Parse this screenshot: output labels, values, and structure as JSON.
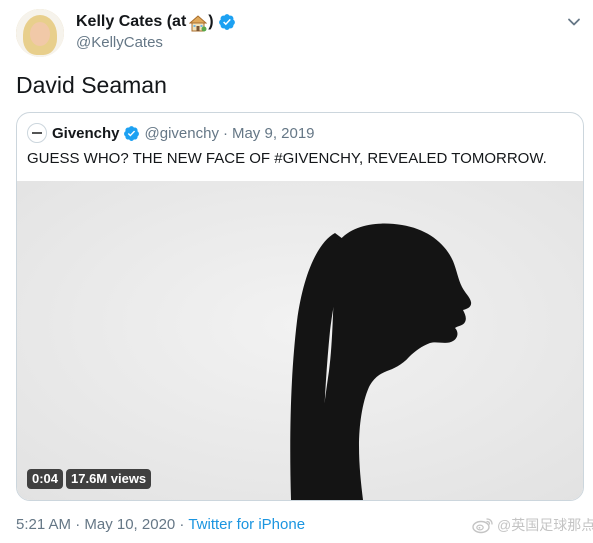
{
  "author": {
    "display_name_prefix": "Kelly Cates (at",
    "display_name_suffix": ")",
    "handle": "@KellyCates",
    "avatar_icon": "profile-photo",
    "verified_icon": "verified-badge-icon"
  },
  "tweet": {
    "text": "David Seaman",
    "timestamp": "5:21 AM · May 10, 2020",
    "separator": " · ",
    "source": "Twitter for iPhone"
  },
  "quoted_tweet": {
    "name": "Givenchy",
    "handle": "@givenchy",
    "dot": "·",
    "date": "May 9, 2019",
    "text": "GUESS WHO? THE NEW FACE OF #GIVENCHY, REVEALED TOMORROW.",
    "video": {
      "duration": "0:04",
      "views": "17.6M views"
    }
  },
  "watermark": {
    "text": "@英国足球那点事",
    "icon": "weibo-icon"
  },
  "colors": {
    "link": "#1b95e0",
    "secondary_text": "#657786",
    "verified": "#1da1f2",
    "border": "#ccd6dd"
  }
}
